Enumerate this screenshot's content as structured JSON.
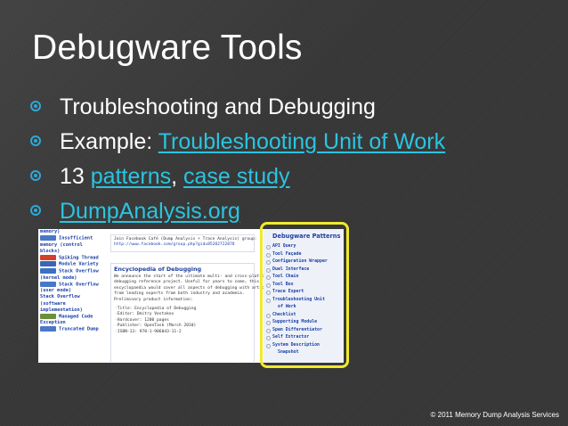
{
  "slide": {
    "title": "Debugware Tools",
    "bullets": [
      {
        "text": "Troubleshooting and Debugging"
      },
      {
        "prefix": "Example: ",
        "link": "Troubleshooting Unit of Work"
      },
      {
        "prefix": "13 ",
        "link1": "patterns",
        "sep": ", ",
        "link2": "case study"
      },
      {
        "link": "DumpAnalysis.org"
      }
    ],
    "footer": "© 2011 Memory Dump Analysis Services"
  },
  "screenshot": {
    "left_nav": [
      {
        "label": "memory)"
      },
      {
        "label": "Insufficient",
        "thumb": "#4a78c8"
      },
      {
        "label": "memory (control"
      },
      {
        "label": "blocks)"
      },
      {
        "label": "Spiking Thread",
        "thumb": "#d0402a"
      },
      {
        "label": "Module Variety",
        "thumb": "#3a66b8"
      },
      {
        "label": "Stack Overflow",
        "thumb": "#3d6fc4"
      },
      {
        "label": "(kernel mode)"
      },
      {
        "label": "Stack Overflow",
        "thumb": "#4a78c8"
      },
      {
        "label": "(user mode)"
      },
      {
        "label": "Stack Overflow"
      },
      {
        "label": "(software"
      },
      {
        "label": "implementation)"
      },
      {
        "label": "Managed Code",
        "thumb": "#6c8f3c"
      },
      {
        "label": "Exception"
      },
      {
        "label": "Truncated Dump",
        "thumb": "#4a78c8"
      }
    ],
    "facebook_box": {
      "lines": [
        "Join Facebook Café (Dump Analysis + Trace Analysis) group:",
        "http://www.facebook.com/group.php?gid=85282722878"
      ]
    },
    "encyclopedia_box": {
      "title": "Encyclopedia of Debugging",
      "lines": [
        "We announce the start of the ultimate multi- and cross-platform",
        "debugging reference project. Useful for years to come, this",
        "encyclopaedia would cover all aspects of debugging with articles",
        "from leading experts from both industry and academia.",
        "Preliminary product information:"
      ],
      "items": [
        "Title: Encyclopedia of Debugging",
        "Editor: Dmitry Vostokov",
        "Hardcover: 1200 pages",
        "Publisher: OpenTask (March 2010)",
        "ISBN-13: 978-1-906043-11-2"
      ]
    },
    "patterns_panel": {
      "title": "Debugware Patterns",
      "items": [
        "API Query",
        "Tool Façade",
        "Configuration Wrapper",
        "Dual Interface",
        "Tool Chain",
        "Tool Box",
        "Trace Expert",
        "Troubleshooting Unit",
        "Checklist",
        "Supporting Module",
        "Span Differentiator",
        "Self Extractor",
        "System Description"
      ],
      "continuations": {
        "Troubleshooting Unit": "of Work",
        "System Description": "Snapshot"
      }
    }
  },
  "colors": {
    "background": "#3a3a3a",
    "link": "#2bc4e0",
    "bullet": "#2ea8d9",
    "highlight": "#f1ea2c"
  }
}
